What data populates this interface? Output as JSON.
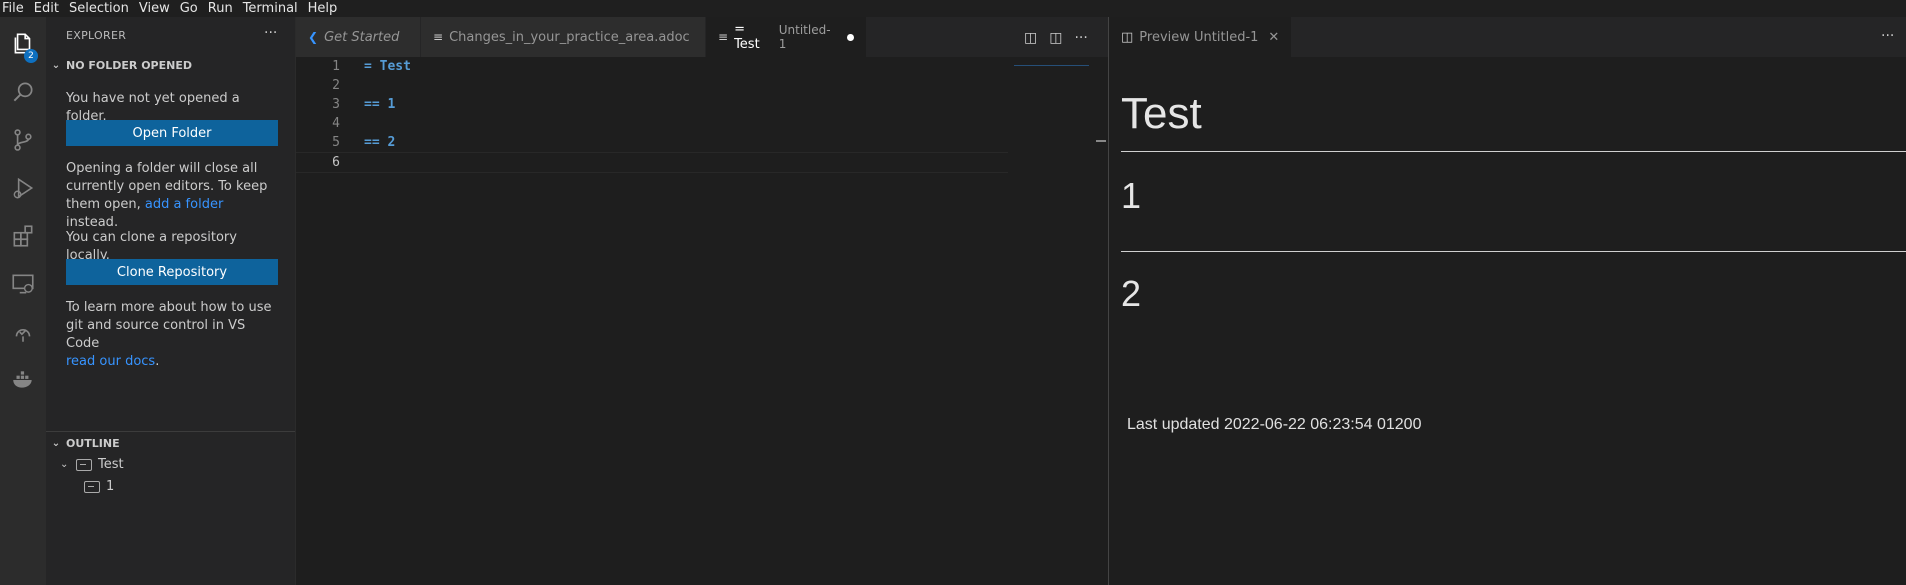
{
  "menu": [
    "File",
    "Edit",
    "Selection",
    "View",
    "Go",
    "Run",
    "Terminal",
    "Help"
  ],
  "activity": {
    "explorer_badge": "2"
  },
  "sidebar": {
    "title": "EXPLORER",
    "more": "···",
    "no_folder": {
      "header": "NO FOLDER OPENED",
      "msg1": "You have not yet opened a folder.",
      "open_button": "Open Folder",
      "msg2_line1": "Opening a folder will close all",
      "msg2_line2": "currently open editors. To keep",
      "msg2_line3_pre": "them open,",
      "msg2_link": "add a folder",
      "msg2_line3_post": "instead.",
      "msg3": "You can clone a repository locally.",
      "clone_button": "Clone Repository",
      "msg4_line1": "To learn more about how to use",
      "msg4_line2": "git and source control in VS Code",
      "msg4_link": "read our docs",
      "msg4_end": "."
    },
    "outline": {
      "header": "OUTLINE",
      "items": [
        {
          "label": "Test"
        },
        {
          "label": "1"
        }
      ]
    }
  },
  "tabs": [
    {
      "label": "Get Started",
      "italic": true
    },
    {
      "label": "Changes_in_your_practice_area.adoc",
      "dirty": true
    },
    {
      "label": "= Test",
      "desc": "Untitled-1",
      "dirty": true,
      "active": true
    }
  ],
  "editor": {
    "lines": [
      {
        "num": "1",
        "text": "= Test"
      },
      {
        "num": "2",
        "text": ""
      },
      {
        "num": "3",
        "text": "== 1"
      },
      {
        "num": "4",
        "text": ""
      },
      {
        "num": "5",
        "text": "== 2"
      },
      {
        "num": "6",
        "text": ""
      }
    ]
  },
  "preview": {
    "tab_label": "Preview Untitled-1",
    "more": "···",
    "h1": "Test",
    "h2a": "1",
    "h2b": "2",
    "footer": "Last updated 2022-06-22 06:23:54 01200"
  },
  "colors": {
    "accent": "#0e639c",
    "link": "#3794ff",
    "keyword": "#569cd6"
  }
}
